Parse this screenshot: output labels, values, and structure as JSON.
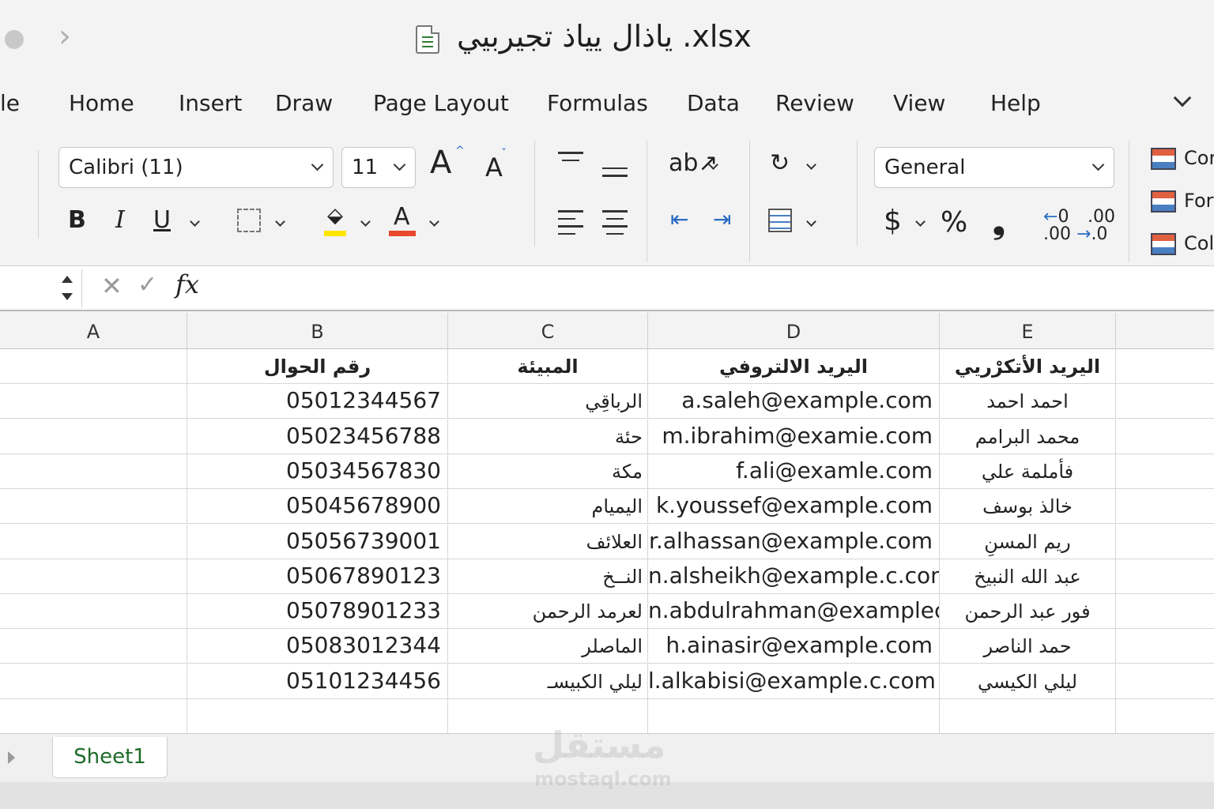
{
  "window": {
    "title": "ياذال يياذ تجيربيي .xlsx"
  },
  "menu": [
    "le",
    "Home",
    "Insert",
    "Draw",
    "Page Layout",
    "Formulas",
    "Data",
    "Review",
    "View",
    "Help"
  ],
  "ribbon": {
    "font_name": "Calibri  (11)",
    "font_size": "11",
    "number_format": "General",
    "bold": "B",
    "italic": "I",
    "underline": "U",
    "font_color_letter": "A",
    "grow_font": "A",
    "shrink_font": "A",
    "currency": "$",
    "percent": "%",
    "comma": "❟",
    "increase_decimal": ".00",
    "decrease_decimal": ".0",
    "styles": [
      "Cor",
      "For",
      "Col"
    ],
    "highlight_color": "#ffe600",
    "font_color": "#e8482c"
  },
  "formula_bar": {
    "cancel": "✕",
    "enter": "✓",
    "fx": "fx"
  },
  "columns": [
    "A",
    "B",
    "C",
    "D",
    "E"
  ],
  "header_row": {
    "B": "رقم الحوال",
    "C": "المبيئة",
    "D": "اليريد الالتروفي",
    "E": "اليريد الأتكرْريي"
  },
  "rows": [
    {
      "B": "05012344567",
      "C": "الرباقِي",
      "D": "a.saleh@example.com",
      "E": "احمد احمد"
    },
    {
      "B": "05023456788",
      "C": "حئة",
      "D": "m.ibrahim@examie.com",
      "E": "محمد البرامم"
    },
    {
      "B": "05034567830",
      "C": "مكة",
      "D": "f.ali@examle.com",
      "E": "فأملمة علي"
    },
    {
      "B": "05045678900",
      "C": "اليميام",
      "D": "k.youssef@example.com",
      "E": "خالذ بوسف"
    },
    {
      "B": "05056739001",
      "C": "العلائف",
      "D": "r.alhassan@example.com",
      "E": "ريم المسنِ"
    },
    {
      "B": "05067890123",
      "C": "النــخ",
      "D": "n.alsheikh@example.c.com",
      "E": "عبد الله النبيخ"
    },
    {
      "B": "05078901233",
      "C": "لعرمد الرحمن",
      "D": "n.abdulrahman@examplec",
      "E": "فور عبد الرحمن"
    },
    {
      "B": "05083012344",
      "C": "الماصلر",
      "D": "h.ainasir@example.com",
      "E": "حمد الناصر"
    },
    {
      "B": "05101234456",
      "C": "ليلي الكبيسـ",
      "D": "l.alkabisi@example.c.com",
      "E": "ليلي الكيسي"
    }
  ],
  "sheets": [
    "Sheet1"
  ],
  "watermark": {
    "main": "مستقل",
    "sub": "mostaql.com"
  }
}
